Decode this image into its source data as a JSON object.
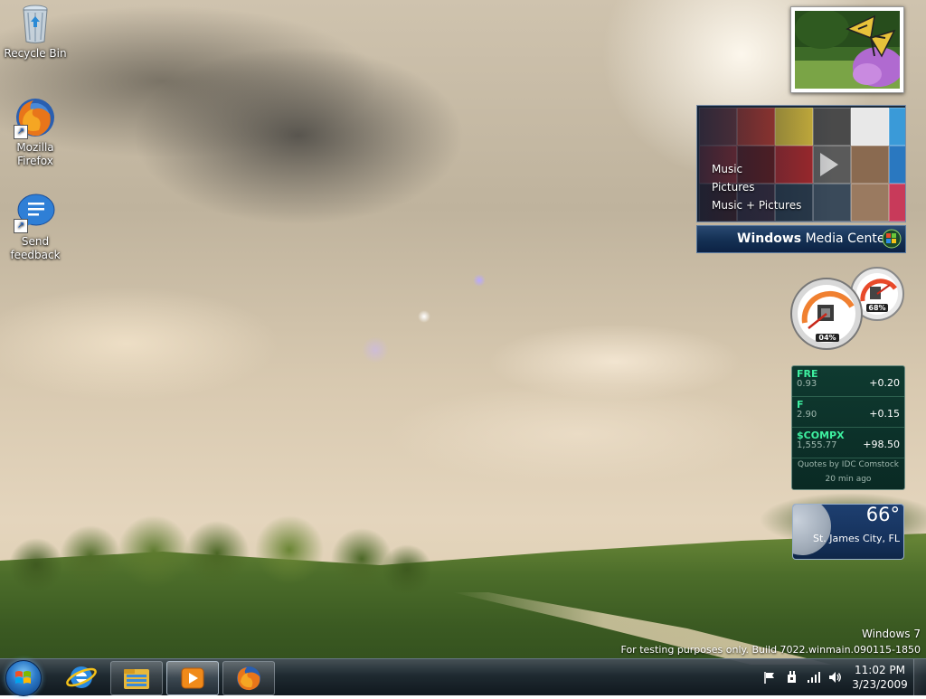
{
  "desktop_icons": [
    {
      "label": "Recycle Bin",
      "icon": "recycle-bin-icon"
    },
    {
      "label": "Mozilla Firefox",
      "icon": "firefox-icon",
      "shortcut": true
    },
    {
      "label": "Send feedback",
      "icon": "send-feedback-icon",
      "shortcut": true
    }
  ],
  "gadgets": {
    "media_center": {
      "menu": [
        "Music",
        "Pictures",
        "Music + Pictures"
      ],
      "brand_bold": "Windows",
      "brand_light": " Media Center"
    },
    "cpu_meter": {
      "cpu_percent": "04%",
      "memory_percent": "68%"
    },
    "stocks": {
      "rows": [
        {
          "symbol": "FRE",
          "price": "0.93",
          "change": "+0.20"
        },
        {
          "symbol": "F",
          "price": "2.90",
          "change": "+0.15"
        },
        {
          "symbol": "$COMPX",
          "price": "1,555.77",
          "change": "+98.50"
        }
      ],
      "footer_source": "Quotes by IDC Comstock",
      "footer_time": "20 min ago"
    },
    "weather": {
      "temperature": "66°",
      "location": "St. James City, FL"
    }
  },
  "watermark": {
    "line1": "Windows 7",
    "line2": "For testing purposes only. Build 7022.winmain.090115-1850"
  },
  "taskbar": {
    "items": [
      {
        "name": "internet-explorer",
        "state": "pinned"
      },
      {
        "name": "windows-explorer",
        "state": "running"
      },
      {
        "name": "windows-media-player",
        "state": "active"
      },
      {
        "name": "firefox",
        "state": "running"
      }
    ],
    "tray_icons": [
      "action-center-flag-icon",
      "power-plug-icon",
      "network-signal-icon",
      "volume-icon"
    ],
    "clock": {
      "time": "11:02 PM",
      "date": "3/23/2009"
    }
  },
  "colors": {
    "taskbar": "#1a2430",
    "stock_symbol": "#3ef0a0",
    "weather_bg": "#1e3f70",
    "media_center_bar": "#153155"
  }
}
